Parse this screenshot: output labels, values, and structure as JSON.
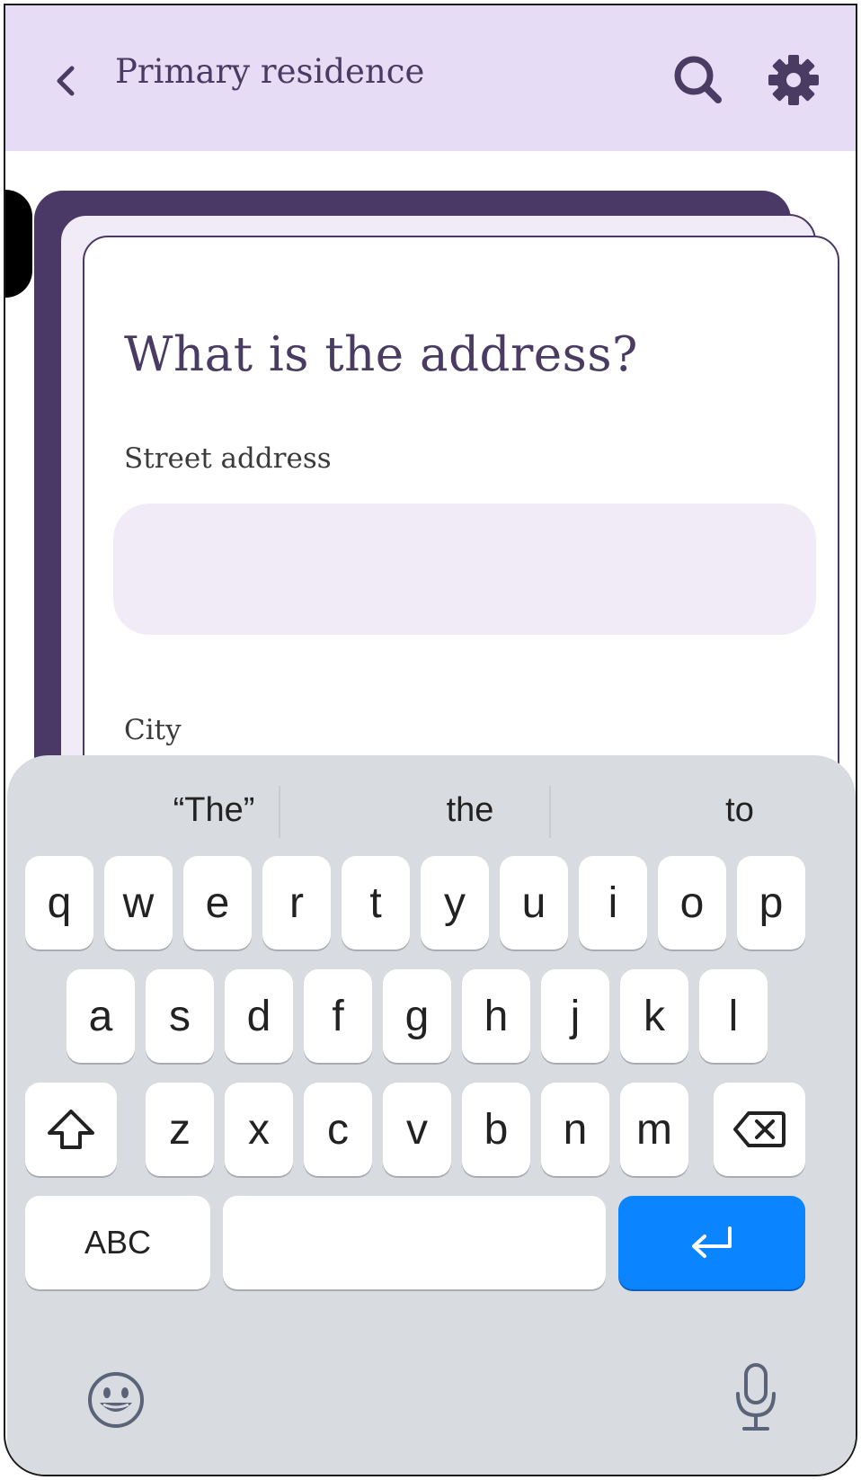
{
  "header": {
    "title": "Primary residence",
    "back_icon": "chevron-left-icon",
    "search_icon": "search-icon",
    "settings_icon": "gear-icon",
    "background_color": "#e6dcf6",
    "text_color": "#4a3b63"
  },
  "form": {
    "question": "What is the address?",
    "street_label": "Street address",
    "street_value": "",
    "city_label": "City",
    "input_background": "#f1ebf7",
    "card_accent": "#4a3966"
  },
  "keyboard": {
    "suggestions": [
      "“The”",
      "the",
      "to"
    ],
    "row1": [
      "q",
      "w",
      "e",
      "r",
      "t",
      "y",
      "u",
      "i",
      "o",
      "p"
    ],
    "row2": [
      "a",
      "s",
      "d",
      "f",
      "g",
      "h",
      "j",
      "k",
      "l"
    ],
    "row3": [
      "z",
      "x",
      "c",
      "v",
      "b",
      "n",
      "m"
    ],
    "shift_icon": "shift-icon",
    "backspace_icon": "backspace-icon",
    "abc_label": "ABC",
    "enter_icon": "return-icon",
    "emoji_icon": "emoji-icon",
    "mic_icon": "microphone-icon",
    "enter_color": "#0a84ff",
    "background_color": "#d8dbe0"
  }
}
